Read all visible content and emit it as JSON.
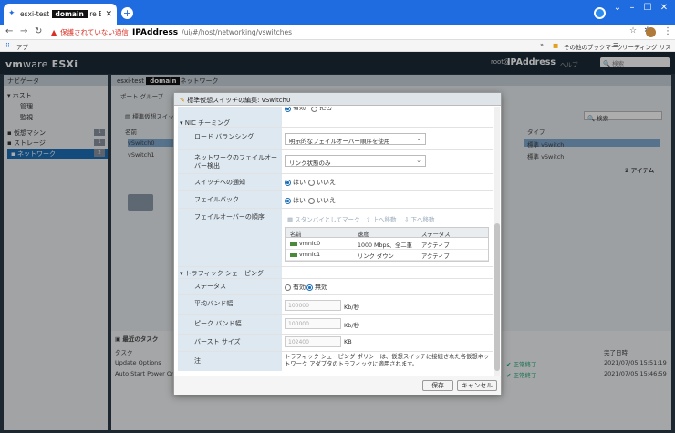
{
  "browser": {
    "tab_title_prefix": "esxi-test",
    "tab_title_domain": "domain",
    "tab_title_suffix": "re ESXi",
    "address": {
      "not_secure": "保護されていない通信",
      "host": "IPAddress",
      "path": "/ui/#/host/networking/vswitches"
    },
    "bookmarks": {
      "apps": "アプ",
      "other": "その他のブックマーク",
      "reading": "リーディング リスト"
    }
  },
  "esxi": {
    "logo_vm": "vm",
    "logo_ware": "ware",
    "logo_product": "ESXi",
    "header_user": "root@",
    "header_host": "IPAddress",
    "help": "ヘルプ",
    "search_placeholder": "検索"
  },
  "navigator": {
    "title": "ナビゲータ",
    "items": [
      {
        "label": "ホスト",
        "level": 0
      },
      {
        "label": "管理",
        "level": 1
      },
      {
        "label": "監視",
        "level": 1
      },
      {
        "label": "仮想マシン",
        "level": 0,
        "count": "1"
      },
      {
        "label": "ストレージ",
        "level": 0,
        "count": "1"
      },
      {
        "label": "ネットワーク",
        "level": 0,
        "count": "2",
        "selected": true
      }
    ]
  },
  "main": {
    "header_prefix": "esxi-test",
    "header_domain": "domain",
    "header_suffix": "ネットワーク",
    "tab_portgroups": "ポート グループ",
    "toolbar_add": "標準仮想スイッチ",
    "col_name": "名前",
    "col_type": "タイプ",
    "rows": [
      "vSwitch0",
      "vSwitch1"
    ],
    "types": [
      "標準 vSwitch",
      "標準 vSwitch"
    ],
    "search": "検索",
    "item_count": "2 アイテム",
    "recent_tasks": "最近のタスク",
    "task_col": "タスク",
    "completion_col": "完了日時",
    "tasks": [
      {
        "name": "Update Options",
        "status": "正常終了",
        "time": "2021/07/05 15:51:19"
      },
      {
        "name": "Auto Start Power On",
        "status": "正常終了",
        "time": "2021/07/05 15:46:59"
      }
    ]
  },
  "dialog": {
    "title": "標準仮想スイッチの編集: vSwitch0",
    "top_cut_left": "有効",
    "top_cut_right": "拒否",
    "nic_teaming": "NIC チーミング",
    "load_balancing_label": "ロード バランシング",
    "load_balancing_value": "明示的なフェイルオーバー順序を使用",
    "failover_detection_label": "ネットワークのフェイルオーバー検出",
    "failover_detection_value": "リンク状態のみ",
    "notify_label": "スイッチへの通知",
    "failback_label": "フェイルバック",
    "yes": "はい",
    "no": "いいえ",
    "order_label": "フェイルオーバーの順序",
    "tb_standby": "スタンバイとしてマーク",
    "tb_up": "上へ移動",
    "tb_down": "下へ移動",
    "table": {
      "headers": [
        "名前",
        "速度",
        "ステータス"
      ],
      "rows": [
        {
          "name": "vmnic0",
          "speed": "1000 Mbps、全二重",
          "status": "アクティブ"
        },
        {
          "name": "vmnic1",
          "speed": "リンク ダウン",
          "status": "アクティブ"
        }
      ]
    },
    "traffic_shaping": "トラフィック シェーピング",
    "status_label": "ステータス",
    "enabled": "有効",
    "disabled": "無効",
    "avg_bw_label": "平均バンド幅",
    "avg_bw_value": "100000",
    "peak_bw_label": "ピーク バンド幅",
    "peak_bw_value": "100000",
    "burst_label": "バースト サイズ",
    "burst_value": "102400",
    "unit_kbps": "Kb/秒",
    "unit_kb": "KB",
    "note_label": "注",
    "note_text": "トラフィック シェーピング ポリシーは、仮想スイッチに接続された各仮想ネットワーク アダプタのトラフィックに適用されます。",
    "save": "保存",
    "cancel": "キャンセル"
  }
}
